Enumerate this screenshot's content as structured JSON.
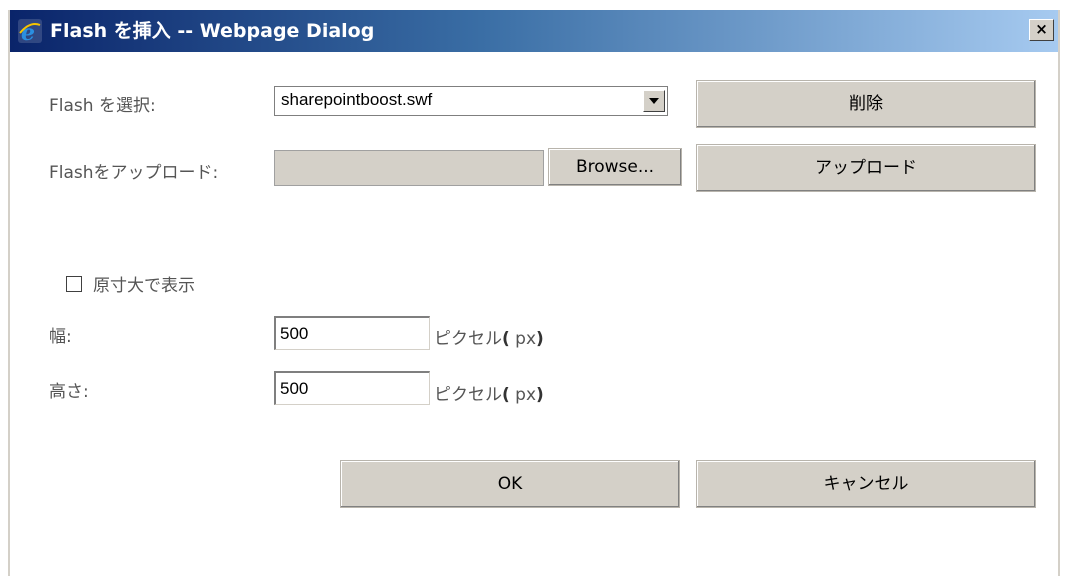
{
  "window": {
    "title": "Flash を挿入 -- Webpage Dialog",
    "close_label": "×"
  },
  "form": {
    "select_flash_label": "Flash を選択:",
    "selected_file": "sharepointboost.swf",
    "upload_flash_label": "Flashをアップロード:",
    "upload_path_value": "",
    "browse_label": "Browse...",
    "delete_label": "削除",
    "upload_label": "アップロード",
    "original_size_label": "原寸大で表示",
    "original_size_checked": false,
    "width_label": "幅:",
    "width_value": "500",
    "height_label": "高さ:",
    "height_value": "500",
    "unit_text": "ピクセル",
    "unit_open": "(",
    "unit_px": " px",
    "unit_close": ")"
  },
  "footer": {
    "ok_label": "OK",
    "cancel_label": "キャンセル"
  }
}
